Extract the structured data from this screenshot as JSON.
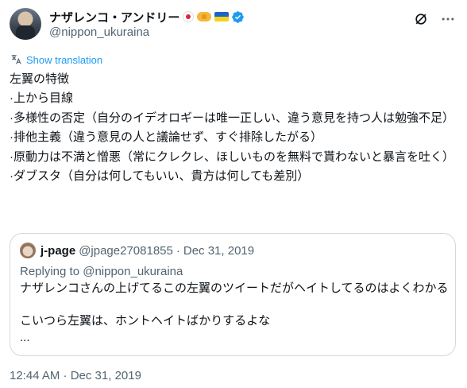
{
  "author": {
    "display_name": "ナザレンコ・アンドリー",
    "handle": "@nippon_ukuraina",
    "badges": [
      "japan-flag-icon",
      "handshake-icon",
      "ukraine-flag-icon",
      "verified-badge-icon"
    ]
  },
  "actions": {
    "grok_icon": "grok-icon",
    "more_icon": "more-icon"
  },
  "translate": {
    "label": "Show translation"
  },
  "body_lines": [
    "左翼の特徴",
    "·上から目線",
    "·多様性の否定（自分のイデオロギーは唯一正しい、違う意見を持つ人は勉強不足）",
    "·排他主義（違う意見の人と議論せず、すぐ排除したがる）",
    "·原動力は不満と憎悪（常にクレクレ、ほしいものを無料で貰わないと暴言を吐く）",
    "·ダブスタ（自分は何してもいい、貴方は何しても差別）"
  ],
  "quote": {
    "name": "j-page",
    "handle": "@jpage27081855",
    "separator": "·",
    "date": "Dec 31, 2019",
    "replying_to": "Replying to @nippon_ukuraina",
    "line1": "ナザレンコさんの上げてるこの左翼のツイートだがヘイトしてるのはよくわかる",
    "line2": "こいつら左翼は、ホントヘイトばかりするよな",
    "line3": "..."
  },
  "timestamp": "12:44 AM · Dec 31, 2019",
  "colors": {
    "link": "#1d9bf0",
    "secondary_text": "#536471",
    "primary_text": "#0f1419",
    "border": "#cfd9de"
  }
}
